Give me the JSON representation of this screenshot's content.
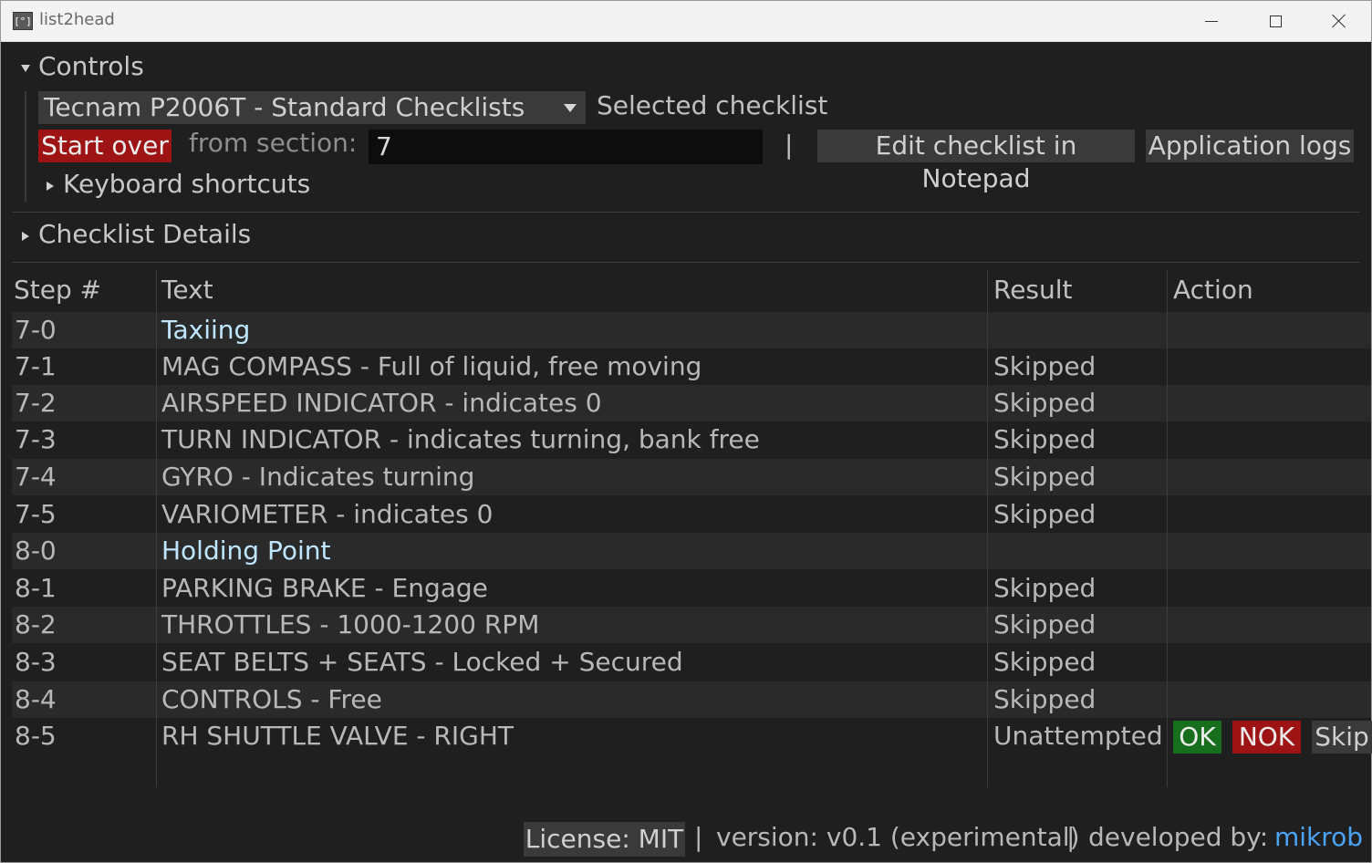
{
  "window": {
    "title": "list2head",
    "app_icon": "[°]",
    "controls": [
      "minimize-icon",
      "maximize-icon",
      "close-icon"
    ]
  },
  "controls": {
    "header": "Controls",
    "checklist_selected": "Tecnam P2006T - Standard Checklists",
    "checklist_label": "Selected checklist",
    "start_over": "Start over",
    "from_section_label": "from section:",
    "from_section_value": "7",
    "separator": "|",
    "edit_button": "Edit checklist in Notepad",
    "logs_button": "Application logs",
    "keyboard_shortcuts": "Keyboard shortcuts"
  },
  "details": {
    "header": "Checklist Details"
  },
  "table": {
    "headers": [
      "Step #",
      "Text",
      "Result",
      "Action"
    ],
    "rows": [
      {
        "step": "7-0",
        "text": "Taxiing",
        "result": "",
        "heading": true
      },
      {
        "step": "7-1",
        "text": "MAG COMPASS - Full of liquid, free moving",
        "result": "Skipped"
      },
      {
        "step": "7-2",
        "text": "AIRSPEED INDICATOR - indicates 0",
        "result": "Skipped"
      },
      {
        "step": "7-3",
        "text": "TURN INDICATOR - indicates turning, bank free",
        "result": "Skipped"
      },
      {
        "step": "7-4",
        "text": "GYRO - Indicates turning",
        "result": "Skipped"
      },
      {
        "step": "7-5",
        "text": "VARIOMETER - indicates 0",
        "result": "Skipped"
      },
      {
        "step": "8-0",
        "text": "Holding Point",
        "result": "",
        "heading": true
      },
      {
        "step": "8-1",
        "text": "PARKING BRAKE - Engage",
        "result": "Skipped"
      },
      {
        "step": "8-2",
        "text": "THROTTLES - 1000-1200 RPM",
        "result": "Skipped"
      },
      {
        "step": "8-3",
        "text": "SEAT BELTS + SEATS - Locked + Secured",
        "result": "Skipped"
      },
      {
        "step": "8-4",
        "text": "CONTROLS - Free",
        "result": "Skipped"
      },
      {
        "step": "8-5",
        "text": "RH SHUTTLE VALVE - RIGHT",
        "result": "Unattempted"
      }
    ],
    "actions": {
      "ok": "OK",
      "nok": "NOK",
      "skip": "Skip"
    }
  },
  "footer": {
    "license": "License: MIT",
    "sep": "|",
    "version": "version: v0.1 (experimental)",
    "developed_by": "developed by:",
    "developer": "mikrob"
  }
}
